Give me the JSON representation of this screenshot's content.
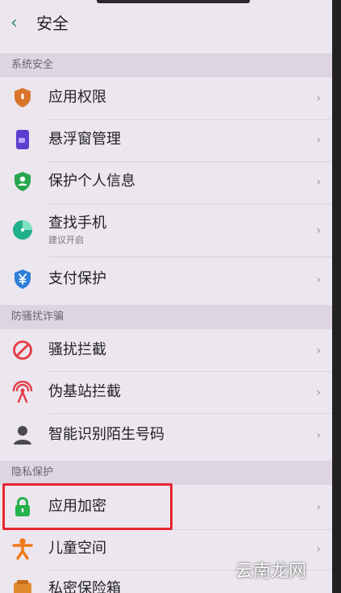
{
  "header": {
    "back_glyph": "‹",
    "title": "安全"
  },
  "sections": {
    "system": "系统安全",
    "antiharass": "防骚扰诈骗",
    "privacy": "隐私保护"
  },
  "items": {
    "app_permissions": "应用权限",
    "floating_window": "悬浮窗管理",
    "personal_info": "保护个人信息",
    "find_phone": "查找手机",
    "find_phone_sub": "建议开启",
    "payment_protect": "支付保护",
    "harass_block": "骚扰拦截",
    "fake_station": "伪基站拦截",
    "smart_id": "智能识别陌生号码",
    "app_encrypt": "应用加密",
    "kids_space": "儿童空间",
    "private_safe": "私密保险箱"
  },
  "chevron": "›",
  "watermark": "云南龙网",
  "colors": {
    "accent_green": "#3a8f62",
    "highlight_red": "#e8252f",
    "background": "#ece6ef",
    "section_bg": "#ddd6e2"
  }
}
